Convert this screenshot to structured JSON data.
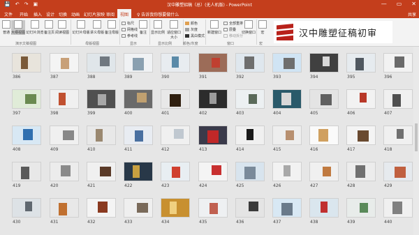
{
  "window": {
    "title": "汉中雕塑招稿（总）(无人机版) - PowerPoint",
    "minimize": "—",
    "restore": "▭",
    "close": "✕"
  },
  "qat": [
    "💾",
    "↶",
    "↷",
    "▣"
  ],
  "tabs": [
    "文件",
    "开始",
    "插入",
    "设计",
    "切换",
    "动画",
    "幻灯片放映",
    "审阅",
    "视图"
  ],
  "active_tab": "视图",
  "tell_me": "♀ 告诉我你想要做什么",
  "user": "共享",
  "ribbon": {
    "buttons": [
      "普通",
      "大纲视图",
      "幻灯片浏览",
      "备注页",
      "阅读视图",
      "幻灯片母版",
      "讲义母版",
      "备注母版",
      "显示比例",
      "适应窗口大小",
      "新建窗口",
      "切换窗口",
      "宏"
    ],
    "checks": [
      "标尺",
      "网格线",
      "参考线"
    ],
    "color_opts": [
      "颜色",
      "灰度",
      "黑白模式"
    ],
    "window_opts": [
      "全部重排",
      "层叠",
      "移动拆分"
    ],
    "notes": "备注",
    "groups": [
      "演示文稿视图",
      "母版视图",
      "显示",
      "显示比例",
      "颜色/灰度",
      "窗口",
      "宏"
    ]
  },
  "logo_text": "汉中雕塑征稿初审",
  "slides": [
    {
      "n": "386",
      "bg": "#e8e4dc",
      "fg": "#7a5a3a"
    },
    {
      "n": "387",
      "bg": "#f4f4f4",
      "fg": "#c8a078"
    },
    {
      "n": "388",
      "bg": "#e0e6ea",
      "fg": "#707880"
    },
    {
      "n": "389",
      "bg": "#f0f2f4",
      "fg": "#8aa0b0"
    },
    {
      "n": "390",
      "bg": "#e8ecf0",
      "fg": "#5a8aa8"
    },
    {
      "n": "391",
      "bg": "#9c6c58",
      "fg": "#c04030"
    },
    {
      "n": "392",
      "bg": "#dfe7ee",
      "fg": "#6e6e6e"
    },
    {
      "n": "393",
      "bg": "#d0e4f4",
      "fg": "#6e6e6e"
    },
    {
      "n": "394",
      "bg": "#404040",
      "fg": "#d8d8d8"
    },
    {
      "n": "395",
      "bg": "#e6ebef",
      "fg": "#505860"
    },
    {
      "n": "396",
      "bg": "#f2f2f2",
      "fg": "#6a6a6a"
    },
    {
      "n": "397",
      "bg": "#e0ecd8",
      "fg": "#6a8a50"
    },
    {
      "n": "398",
      "bg": "#f0f0f0",
      "fg": "#c05030"
    },
    {
      "n": "399",
      "bg": "#505050",
      "fg": "#a8a8a8"
    },
    {
      "n": "400",
      "bg": "#6a6a6a",
      "fg": "#c0a070"
    },
    {
      "n": "401",
      "bg": "#e8e8e8",
      "fg": "#302010"
    },
    {
      "n": "402",
      "bg": "#2c2c2c",
      "fg": "#9c9c9c"
    },
    {
      "n": "403",
      "bg": "#ecf0f2",
      "fg": "#5a6a5a"
    },
    {
      "n": "404",
      "bg": "#2a5a6a",
      "fg": "#d8d8d8"
    },
    {
      "n": "405",
      "bg": "#e4e4e4",
      "fg": "#606060"
    },
    {
      "n": "406",
      "bg": "#f2f2f2",
      "fg": "#b83828"
    },
    {
      "n": "407",
      "bg": "#f0f0f0",
      "fg": "#505050"
    },
    {
      "n": "408",
      "bg": "#d8e8f4",
      "fg": "#3070b0"
    },
    {
      "n": "409",
      "bg": "#f0f0f0",
      "fg": "#888888"
    },
    {
      "n": "410",
      "bg": "#e8e8e8",
      "fg": "#9a8870"
    },
    {
      "n": "411",
      "bg": "#e8ecf2",
      "fg": "#4a70a0"
    },
    {
      "n": "412",
      "bg": "#f0f0f0",
      "fg": "#c0c8d0"
    },
    {
      "n": "413",
      "bg": "#3a3a4a",
      "fg": "#c02828"
    },
    {
      "n": "414",
      "bg": "#f0f0f0",
      "fg": "#1a1a1a"
    },
    {
      "n": "415",
      "bg": "#eeeeee",
      "fg": "#b89070"
    },
    {
      "n": "416",
      "bg": "#fafafa",
      "fg": "#d0a060"
    },
    {
      "n": "417",
      "bg": "#f4f4f4",
      "fg": "#6a4a30"
    },
    {
      "n": "418",
      "bg": "#f0f0f0",
      "fg": "#707070"
    },
    {
      "n": "419",
      "bg": "#e8e8e8",
      "fg": "#5a5a5a"
    },
    {
      "n": "420",
      "bg": "#ececec",
      "fg": "#8a8a8a"
    },
    {
      "n": "421",
      "bg": "#f0f0f0",
      "fg": "#5a3a28"
    },
    {
      "n": "422",
      "bg": "#283848",
      "fg": "#c8a040"
    },
    {
      "n": "423",
      "bg": "#e8eef2",
      "fg": "#d04030"
    },
    {
      "n": "424",
      "bg": "#f4f4f4",
      "fg": "#c83030"
    },
    {
      "n": "425",
      "bg": "#d8e4ee",
      "fg": "#7a8a9a"
    },
    {
      "n": "426",
      "bg": "#f2f2f2",
      "fg": "#a8a8a8"
    },
    {
      "n": "427",
      "bg": "#f0f0f0",
      "fg": "#c07a40"
    },
    {
      "n": "428",
      "bg": "#ececec",
      "fg": "#707070"
    },
    {
      "n": "429",
      "bg": "#e6eaee",
      "fg": "#c06040"
    },
    {
      "n": "430",
      "bg": "#dde2e6",
      "fg": "#606870"
    },
    {
      "n": "431",
      "bg": "#e8e8e8",
      "fg": "#c07030"
    },
    {
      "n": "432",
      "bg": "#f4f4f4",
      "fg": "#8a3a20"
    },
    {
      "n": "433",
      "bg": "#efefef",
      "fg": "#7a6a5a"
    },
    {
      "n": "434",
      "bg": "#c89030",
      "fg": "#f0d080"
    },
    {
      "n": "435",
      "bg": "#eef0f2",
      "fg": "#c06050"
    },
    {
      "n": "436",
      "bg": "#e4e4e4",
      "fg": "#3a3a3a"
    },
    {
      "n": "437",
      "bg": "#d8e8f4",
      "fg": "#6a7a8a"
    },
    {
      "n": "438",
      "bg": "#dae6ee",
      "fg": "#c03030"
    },
    {
      "n": "439",
      "bg": "#e8ecea",
      "fg": "#5a8a5a"
    },
    {
      "n": "440",
      "bg": "#f0f0f0",
      "fg": "#808080"
    }
  ]
}
